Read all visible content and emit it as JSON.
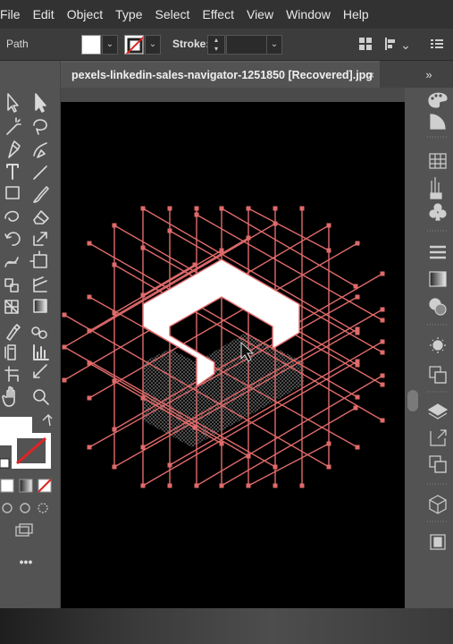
{
  "menu": {
    "items": [
      "File",
      "Edit",
      "Object",
      "Type",
      "Select",
      "Effect",
      "View",
      "Window",
      "Help"
    ]
  },
  "control_bar": {
    "selection_label": "Path",
    "stroke_label": "Stroke:",
    "stroke_value": "",
    "fill_color": "#ffffff"
  },
  "document": {
    "tab_title": "pexels-linkedin-sales-navigator-1251850 [Recovered].jpg",
    "close_glyph": "×"
  },
  "panels": {
    "collapse_glyph": "»",
    "more_tools_glyph": "•••"
  },
  "colors": {
    "grid_line": "#e06a6a",
    "artboard": "#000000",
    "shape_fill": "#ffffff",
    "ui_dark": "#323232",
    "ui_mid": "#535353"
  },
  "icons": {
    "left_toolbar": [
      "selection-tool-icon",
      "direct-selection-tool-icon",
      "magic-wand-icon",
      "lasso-icon",
      "pen-tool-icon",
      "curvature-tool-icon",
      "type-tool-icon",
      "line-tool-icon",
      "rectangle-tool-icon",
      "paintbrush-icon",
      "shaper-tool-icon",
      "eraser-icon",
      "rotate-tool-icon",
      "scale-tool-icon",
      "warp-tool-icon",
      "free-transform-icon",
      "shape-builder-icon",
      "perspective-grid-icon",
      "mesh-tool-icon",
      "gradient-tool-icon",
      "eyedropper-icon",
      "blend-tool-icon",
      "symbol-sprayer-icon",
      "column-graph-icon",
      "artboard-tool-icon",
      "slice-tool-icon",
      "hand-tool-icon",
      "zoom-tool-icon"
    ],
    "right_dock": [
      "color-panel-icon",
      "color-guide-icon",
      "swatches-icon",
      "brushes-icon",
      "symbols-icon",
      "stroke-panel-icon",
      "gradient-panel-icon",
      "transparency-icon",
      "appearance-icon",
      "graphic-styles-icon",
      "layers-icon",
      "export-icon",
      "artboards-icon",
      "3d-icon",
      "libraries-icon"
    ]
  }
}
